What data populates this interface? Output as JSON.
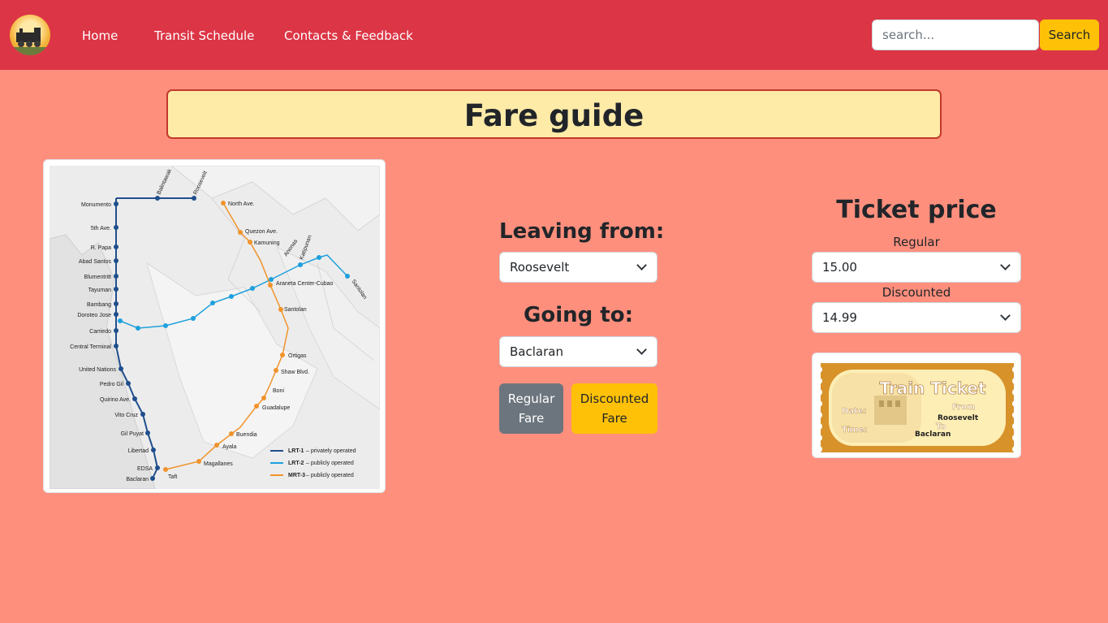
{
  "nav": {
    "logo_alt": "train logo",
    "links": [
      "Home",
      "Transit Schedule",
      "Contacts & Feedback"
    ],
    "search_placeholder": "search...",
    "search_label": "Search"
  },
  "page": {
    "title": "Fare guide"
  },
  "map": {
    "stations_lrt1": [
      "Monumento",
      "5th Ave.",
      "R. Papa",
      "Abad Santos",
      "Blumentritt",
      "Tayuman",
      "Bambang",
      "Doroteo Jose",
      "Carriedo",
      "Central Terminal",
      "United Nations",
      "Pedro Gil",
      "Quirino Ave.",
      "Vito Cruz",
      "Gil Puyat",
      "Libertad",
      "EDSA",
      "Baclaran"
    ],
    "stations_top": [
      "Balintawak",
      "Roosevelt"
    ],
    "stations_lrt2": [
      "Araneta Center-Cubao",
      "Katipunan",
      "Anonas",
      "Santolan"
    ],
    "stations_mrt3": [
      "North Ave.",
      "Quezon Ave.",
      "Kamuning",
      "Santolan",
      "Ortigas",
      "Shaw Blvd.",
      "Boni",
      "Guadalupe",
      "Buendia",
      "Ayala",
      "Magallanes",
      "Taft"
    ],
    "legend": [
      {
        "name": "LRT-1",
        "desc": "– privately operated",
        "color": "#1f4e8c"
      },
      {
        "name": "LRT-2",
        "desc": "– publicly operated",
        "color": "#1ea0dc"
      },
      {
        "name": "MRT-3",
        "desc": "– publicly operated",
        "color": "#f0932b"
      }
    ]
  },
  "form": {
    "leaving_label": "Leaving from:",
    "leaving_value": "Roosevelt",
    "going_label": "Going to:",
    "going_value": "Baclaran",
    "regular_button": "Regular Fare",
    "discounted_button": "Discounted Fare"
  },
  "price": {
    "heading": "Ticket price",
    "regular_label": "Regular",
    "regular_value": "15.00",
    "discounted_label": "Discounted",
    "discounted_value": "14.99"
  },
  "ticket": {
    "title": "Train Ticket",
    "date_label": "Date:",
    "time_label": "Time:",
    "from_label": "From",
    "from_value": "Roosevelt",
    "to_label": "To",
    "to_value": "Baclaran"
  },
  "colors": {
    "navbar": "#dc3545",
    "background": "#ff8f7d",
    "title_box": "#ffeba8",
    "accent_yellow": "#ffc107",
    "secondary_gray": "#6c757d"
  }
}
